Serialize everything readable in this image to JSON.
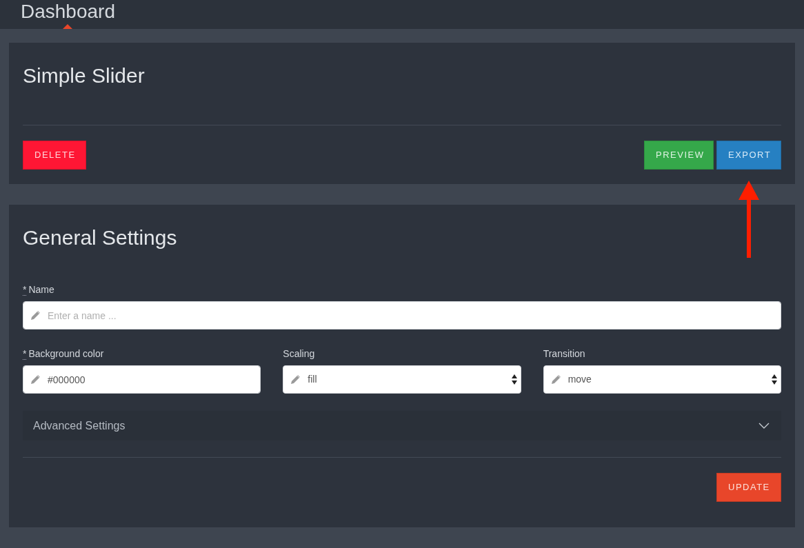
{
  "nav": [
    {
      "label": "Dashboard",
      "selected": true
    }
  ],
  "slider_panel": {
    "title": "Simple Slider",
    "actions_left": [
      {
        "label": "DELETE",
        "kind": "delete",
        "annotated": false
      }
    ],
    "actions_right": [
      {
        "label": "PREVIEW",
        "kind": "preview",
        "annotated": false
      },
      {
        "label": "EXPORT",
        "kind": "export",
        "annotated": true
      }
    ]
  },
  "general_settings": {
    "title": "General Settings",
    "rows": [
      {
        "fields": [
          {
            "marker": "*",
            "label": "Name",
            "kind": "text",
            "placeholder": "Enter a name ..."
          }
        ]
      },
      {
        "fields": [
          {
            "marker": "*",
            "label": "Background color",
            "kind": "text",
            "value": "#000000"
          },
          {
            "label": "Scaling",
            "kind": "select",
            "value": "fill"
          },
          {
            "label": "Transition",
            "kind": "select",
            "value": "move"
          }
        ]
      }
    ],
    "advanced": {
      "label": "Advanced Settings",
      "expanded": false
    },
    "actions_right": [
      {
        "label": "UPDATE",
        "kind": "update",
        "annotated": false
      }
    ]
  }
}
